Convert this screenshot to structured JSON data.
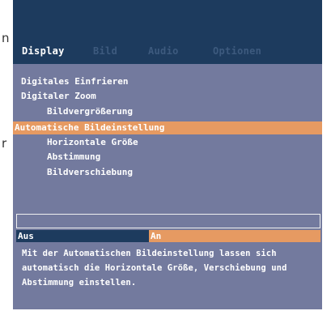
{
  "edge_text": [
    "n",
    "r"
  ],
  "tabs": [
    {
      "label": "Display",
      "active": true
    },
    {
      "label": "Bild",
      "active": false
    },
    {
      "label": "Audio",
      "active": false
    },
    {
      "label": "Optionen",
      "active": false
    }
  ],
  "menu": {
    "items": [
      {
        "label": "Digitales Einfrieren",
        "level": 0,
        "selected": false
      },
      {
        "label": "Digitaler Zoom",
        "level": 0,
        "selected": false
      },
      {
        "label": "Bildvergrößerung",
        "level": 1,
        "selected": false
      },
      {
        "label": "Automatische Bildeinstellung",
        "level": 0,
        "selected": true
      },
      {
        "label": "Horizontale Größe",
        "level": 1,
        "selected": false
      },
      {
        "label": "Abstimmung",
        "level": 1,
        "selected": false
      },
      {
        "label": "Bildverschiebung",
        "level": 1,
        "selected": false
      }
    ]
  },
  "value_box": {
    "text": ""
  },
  "options": [
    {
      "label": "Aus",
      "selected": false
    },
    {
      "label": "An",
      "selected": true
    }
  ],
  "description": "Mit der Automatischen Bildeinstellung lassen sich automatisch die Horizontale Größe, Verschiebung und Abstimmung einstellen.",
  "colors": {
    "header_bg": "#1d3b5e",
    "panel_bg": "#737a9e",
    "highlight": "#e69a62",
    "inactive_tab": "#3d5a7e",
    "text": "#ffffff"
  }
}
